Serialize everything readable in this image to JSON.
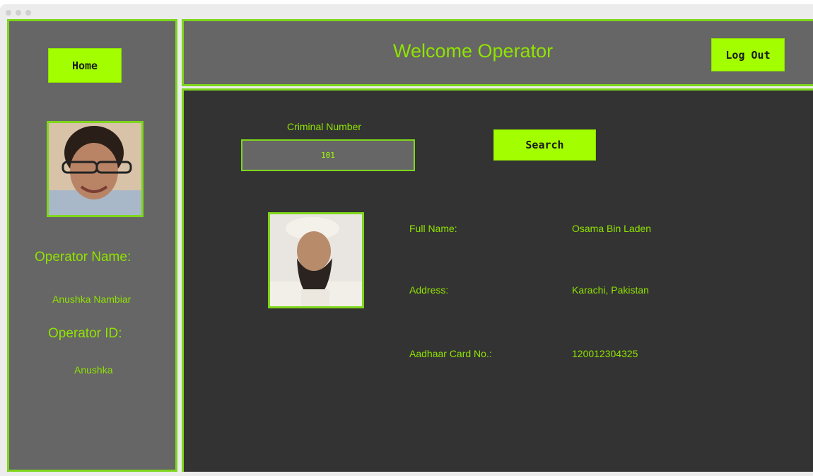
{
  "sidebar": {
    "home_label": "Home",
    "operator_name_label": "Operator Name:",
    "operator_name_value": "Anushka Nambiar",
    "operator_id_label": "Operator ID:",
    "operator_id_value": "Anushka"
  },
  "header": {
    "title": "Welcome Operator",
    "logout_label": "Log Out"
  },
  "search": {
    "field_label": "Criminal Number",
    "field_value": "101",
    "button_label": "Search"
  },
  "record": {
    "fields": [
      {
        "label": "Full Name:",
        "value": "Osama Bin Laden"
      },
      {
        "label": "Address:",
        "value": "Karachi, Pakistan"
      },
      {
        "label": "Aadhaar Card No.:",
        "value": "120012304325"
      }
    ]
  },
  "colors": {
    "accent": "#a3ff00",
    "text_green": "#8fe300",
    "panel": "#666666",
    "main_bg": "#333333"
  }
}
